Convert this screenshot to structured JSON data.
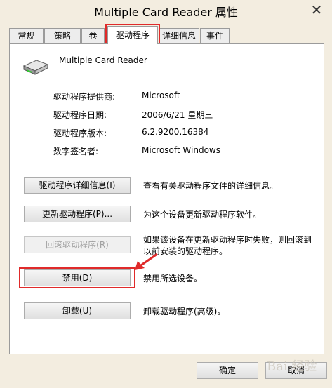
{
  "window": {
    "title": "Multiple Card Reader 属性",
    "close_glyph": "✕"
  },
  "tabs": [
    {
      "label": "常规",
      "icon": "none"
    },
    {
      "label": "策略",
      "icon": "none"
    },
    {
      "label": "卷",
      "icon": "none"
    },
    {
      "label": "驱动程序",
      "active": true
    },
    {
      "label": "详细信息"
    },
    {
      "label": "事件"
    }
  ],
  "device": {
    "icon": "card-reader-icon",
    "name": "Multiple Card Reader"
  },
  "driver_info": [
    {
      "label": "驱动程序提供商:",
      "value": "Microsoft"
    },
    {
      "label": "驱动程序日期:",
      "value": "2006/6/21 星期三"
    },
    {
      "label": "驱动程序版本:",
      "value": "6.2.9200.16384"
    },
    {
      "label": "数字签名者:",
      "value": "Microsoft Windows"
    }
  ],
  "actions": [
    {
      "button": "驱动程序详细信息(I)",
      "description": "查看有关驱动程序文件的详细信息。",
      "enabled": true
    },
    {
      "button": "更新驱动程序(P)...",
      "description": "为这个设备更新驱动程序软件。",
      "enabled": true
    },
    {
      "button": "回滚驱动程序(R)",
      "description": "如果该设备在更新驱动程序时失败，则回滚到以前安装的驱动程序。",
      "enabled": false
    },
    {
      "button": "禁用(D)",
      "description": "禁用所选设备。",
      "enabled": true
    },
    {
      "button": "卸载(U)",
      "description": "卸载驱动程序(高级)。",
      "enabled": true
    }
  ],
  "footer": {
    "ok": "确定",
    "cancel": "取消"
  },
  "watermark": "Bai 经验",
  "colors": {
    "highlight": "#e02a2a",
    "window_bg": "#f3ede0"
  }
}
